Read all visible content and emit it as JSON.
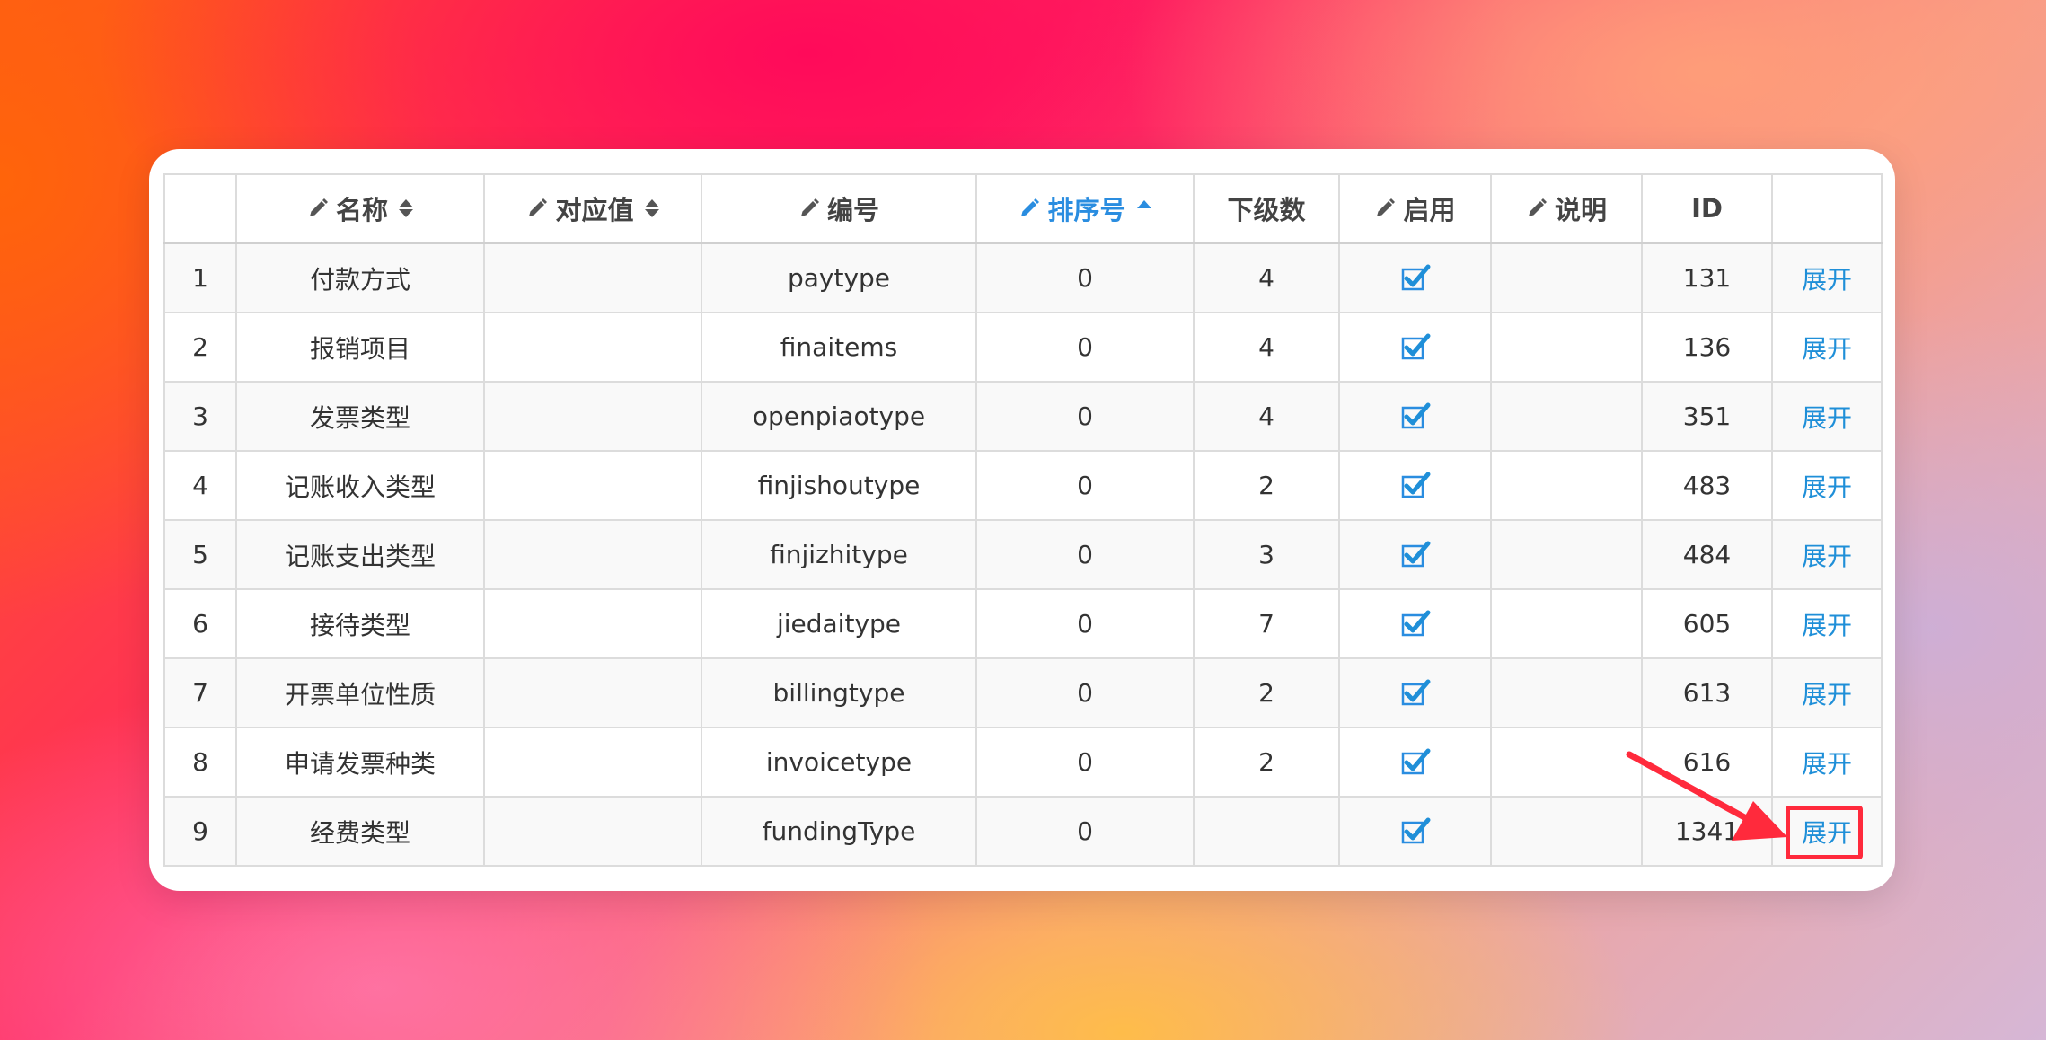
{
  "table": {
    "columns": [
      {
        "key": "index",
        "label": "",
        "editable": false,
        "sort": "none"
      },
      {
        "key": "name",
        "label": "名称",
        "editable": true,
        "sort": "both"
      },
      {
        "key": "value",
        "label": "对应值",
        "editable": true,
        "sort": "both"
      },
      {
        "key": "code",
        "label": "编号",
        "editable": true,
        "sort": "none"
      },
      {
        "key": "order",
        "label": "排序号",
        "editable": true,
        "sort": "asc"
      },
      {
        "key": "children",
        "label": "下级数",
        "editable": false,
        "sort": "none"
      },
      {
        "key": "enabled",
        "label": "启用",
        "editable": true,
        "sort": "none"
      },
      {
        "key": "remark",
        "label": "说明",
        "editable": true,
        "sort": "none"
      },
      {
        "key": "id",
        "label": "ID",
        "editable": false,
        "sort": "none"
      },
      {
        "key": "action",
        "label": "",
        "editable": false,
        "sort": "none"
      }
    ],
    "rows": [
      {
        "index": "1",
        "name": "付款方式",
        "value": "",
        "code": "paytype",
        "order": "0",
        "children": "4",
        "enabled": true,
        "remark": "",
        "id": "131",
        "action": "展开"
      },
      {
        "index": "2",
        "name": "报销项目",
        "value": "",
        "code": "finaitems",
        "order": "0",
        "children": "4",
        "enabled": true,
        "remark": "",
        "id": "136",
        "action": "展开"
      },
      {
        "index": "3",
        "name": "发票类型",
        "value": "",
        "code": "openpiaotype",
        "order": "0",
        "children": "4",
        "enabled": true,
        "remark": "",
        "id": "351",
        "action": "展开"
      },
      {
        "index": "4",
        "name": "记账收入类型",
        "value": "",
        "code": "finjishoutype",
        "order": "0",
        "children": "2",
        "enabled": true,
        "remark": "",
        "id": "483",
        "action": "展开"
      },
      {
        "index": "5",
        "name": "记账支出类型",
        "value": "",
        "code": "finjizhitype",
        "order": "0",
        "children": "3",
        "enabled": true,
        "remark": "",
        "id": "484",
        "action": "展开"
      },
      {
        "index": "6",
        "name": "接待类型",
        "value": "",
        "code": "jiedaitype",
        "order": "0",
        "children": "7",
        "enabled": true,
        "remark": "",
        "id": "605",
        "action": "展开"
      },
      {
        "index": "7",
        "name": "开票单位性质",
        "value": "",
        "code": "billingtype",
        "order": "0",
        "children": "2",
        "enabled": true,
        "remark": "",
        "id": "613",
        "action": "展开"
      },
      {
        "index": "8",
        "name": "申请发票种类",
        "value": "",
        "code": "invoicetype",
        "order": "0",
        "children": "2",
        "enabled": true,
        "remark": "",
        "id": "616",
        "action": "展开"
      },
      {
        "index": "9",
        "name": "经费类型",
        "value": "",
        "code": "fundingType",
        "order": "0",
        "children": "",
        "enabled": true,
        "remark": "",
        "id": "1341",
        "action": "展开"
      }
    ]
  },
  "colors": {
    "accent": "#2a8de0",
    "link": "#1f8fd8",
    "annotation": "#ff2a3c"
  },
  "icons": {
    "edit": "pencil-icon",
    "sort_both": "sort-icon",
    "sort_asc": "sort-asc-icon",
    "enabled": "checkbox-checked-icon"
  }
}
